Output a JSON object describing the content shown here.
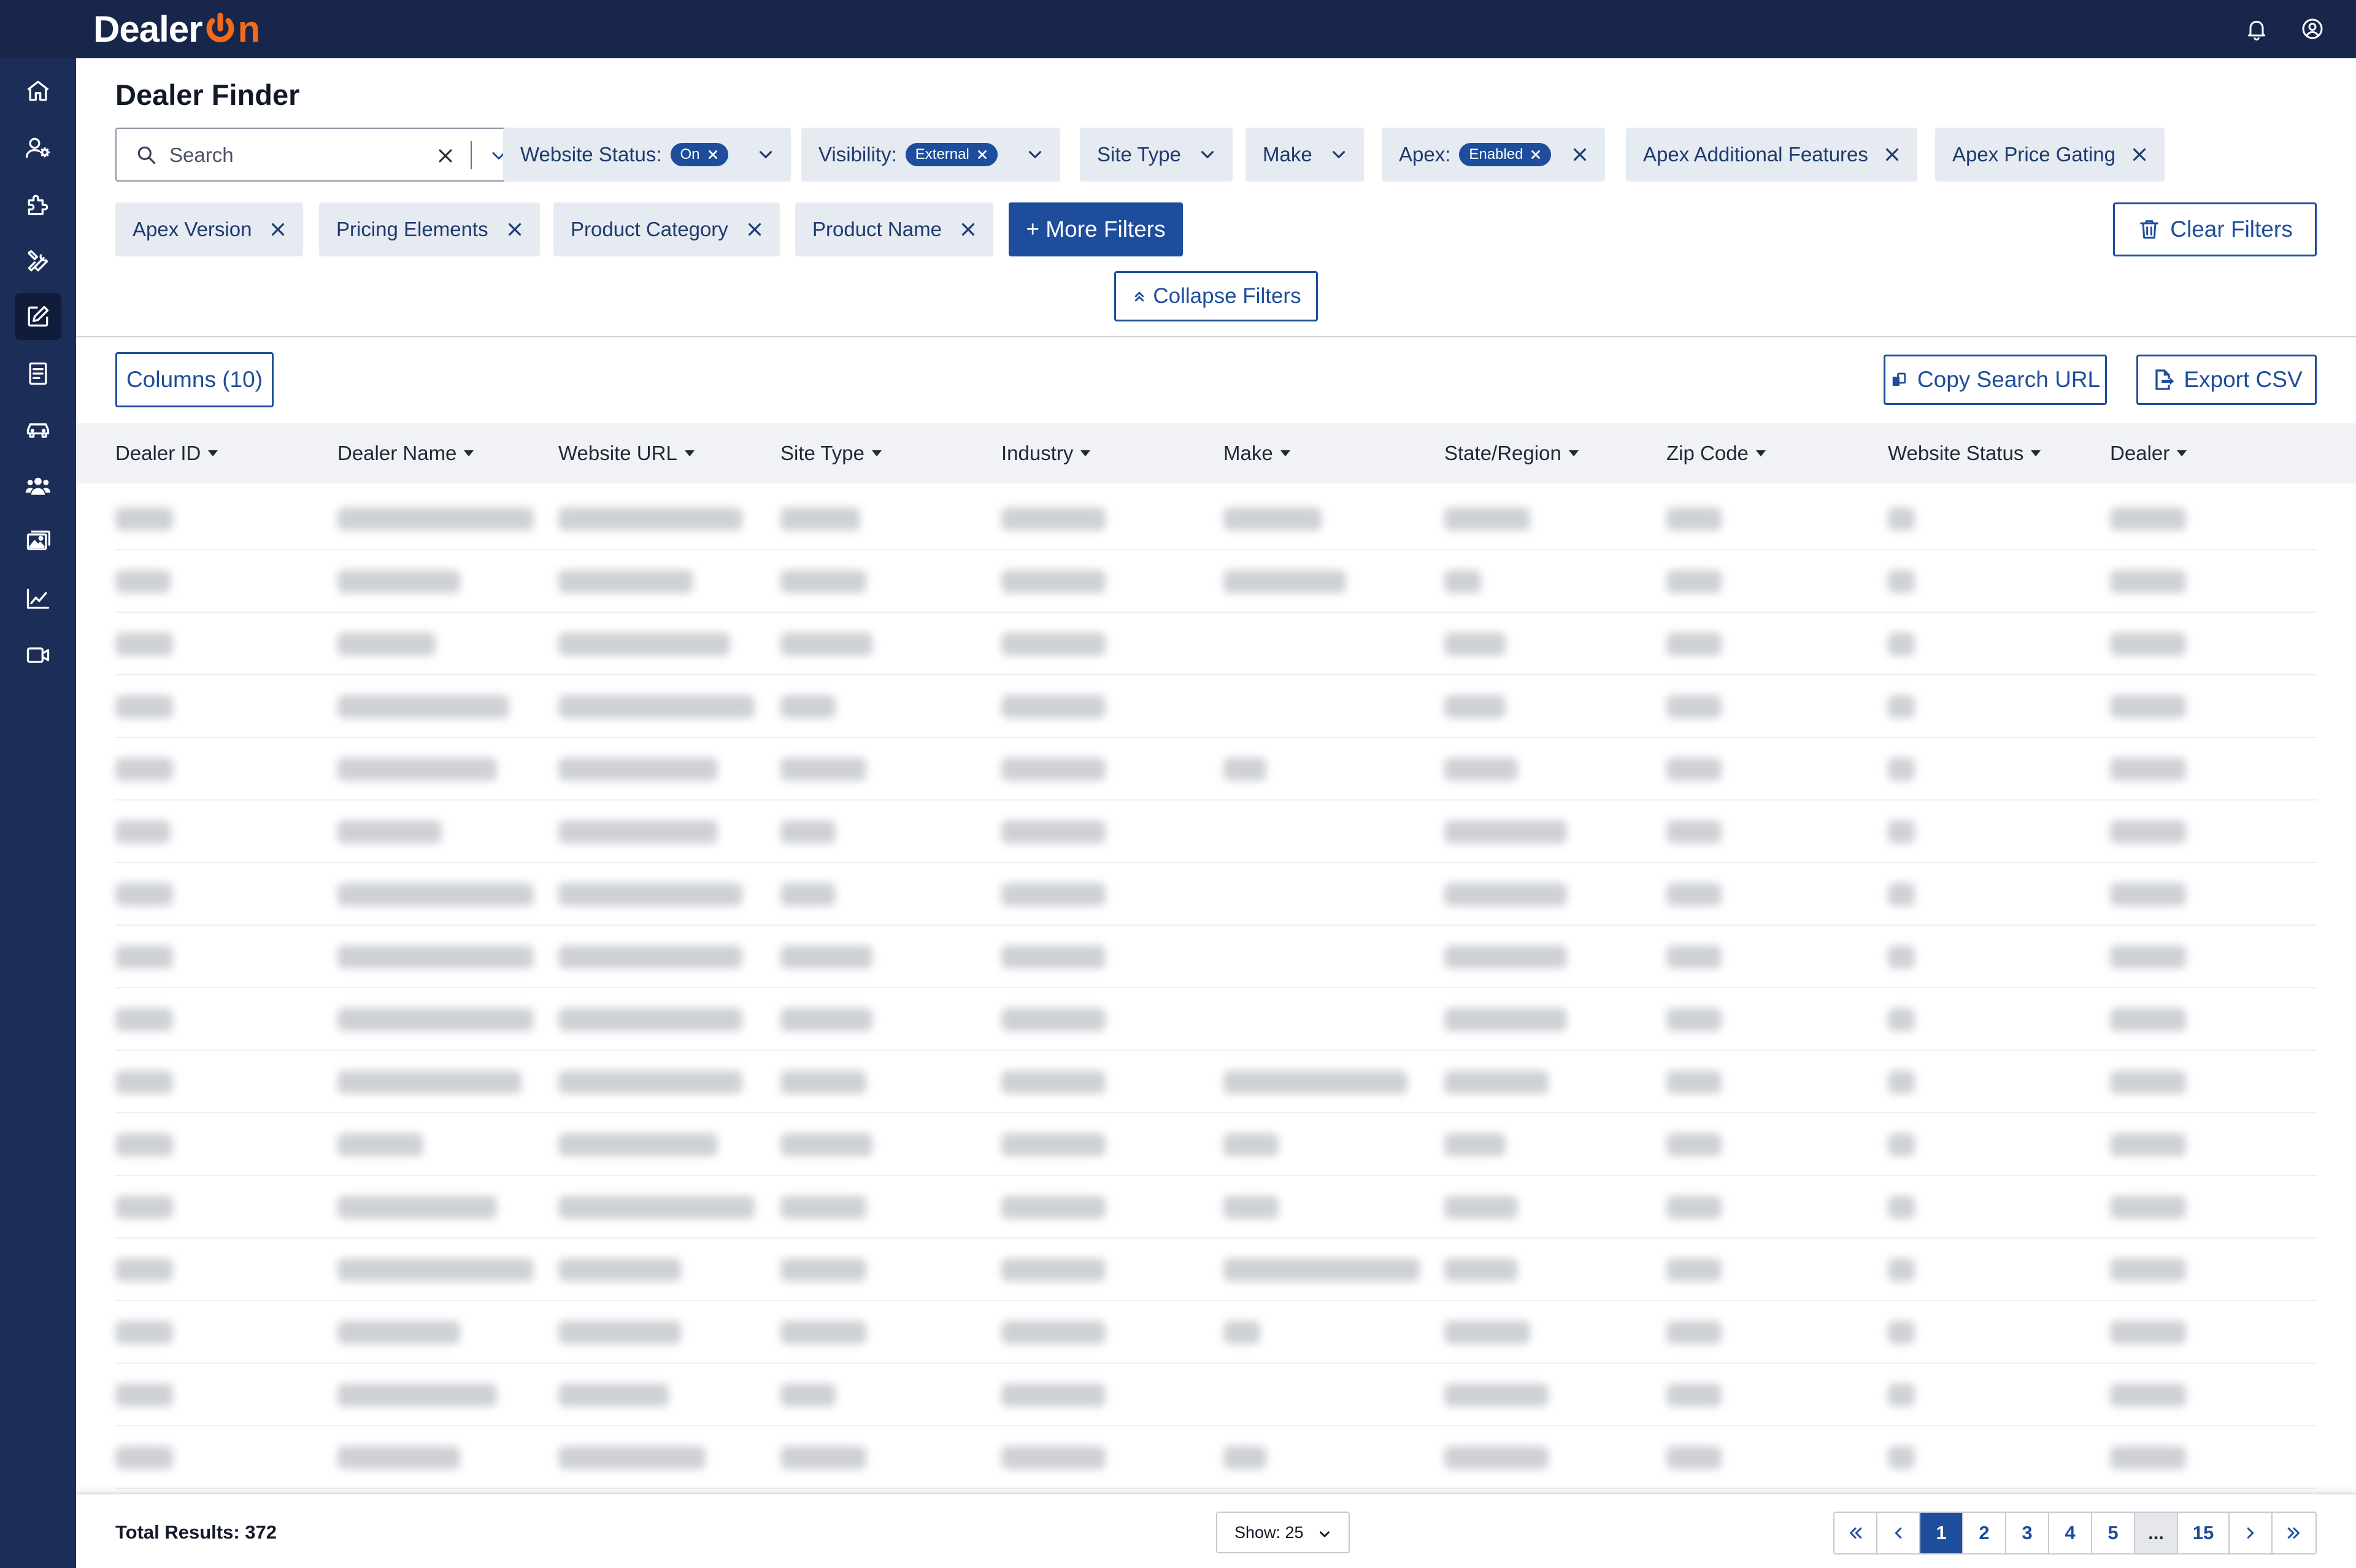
{
  "app": {
    "logo_text_dealer": "Dealer",
    "logo_text_on": "n",
    "brand_color": "#f26b1d"
  },
  "sidebar": {
    "items": [
      {
        "icon": "home-icon"
      },
      {
        "icon": "user-settings-icon"
      },
      {
        "icon": "puzzle-icon"
      },
      {
        "icon": "tools-icon"
      },
      {
        "icon": "edit-icon",
        "active": true
      },
      {
        "icon": "receipt-icon"
      },
      {
        "icon": "car-icon"
      },
      {
        "icon": "users-icon"
      },
      {
        "icon": "image-gallery-icon"
      },
      {
        "icon": "chart-line-icon"
      },
      {
        "icon": "video-icon"
      }
    ]
  },
  "page": {
    "title": "Dealer Finder"
  },
  "search": {
    "placeholder": "Search",
    "value": ""
  },
  "filters": {
    "website_status": {
      "label": "Website Status:",
      "value": "On"
    },
    "visibility": {
      "label": "Visibility:",
      "value": "External"
    },
    "site_type": {
      "label": "Site Type"
    },
    "make": {
      "label": "Make"
    },
    "apex": {
      "label": "Apex:",
      "value": "Enabled"
    },
    "apex_additional_features": {
      "label": "Apex Additional Features"
    },
    "apex_price_gating": {
      "label": "Apex Price Gating"
    },
    "apex_version": {
      "label": "Apex Version"
    },
    "pricing_elements": {
      "label": "Pricing Elements"
    },
    "product_category": {
      "label": "Product Category"
    },
    "product_name": {
      "label": "Product Name"
    },
    "more_filters": "+ More Filters",
    "clear_filters": "Clear Filters",
    "collapse_filters": "Collapse Filters"
  },
  "toolbar": {
    "columns": "Columns (10)",
    "copy_search_url": "Copy Search URL",
    "export_csv": "Export CSV"
  },
  "table": {
    "columns": [
      "Dealer ID",
      "Dealer Name",
      "Website URL",
      "Site Type",
      "Industry",
      "Make",
      "State/Region",
      "Zip Code",
      "Website Status",
      "Dealer"
    ],
    "rows_note_blurred": true
  },
  "footer": {
    "total_results": "Total Results: 372",
    "show": "Show: 25",
    "pages": [
      "1",
      "2",
      "3",
      "4",
      "5",
      "...",
      "15"
    ],
    "current_page": "1"
  },
  "colors": {
    "topbar": "#17264a",
    "sidebar": "#1c2d57",
    "primary": "#1e4d9c",
    "chip_bg": "#e6ebf2"
  }
}
